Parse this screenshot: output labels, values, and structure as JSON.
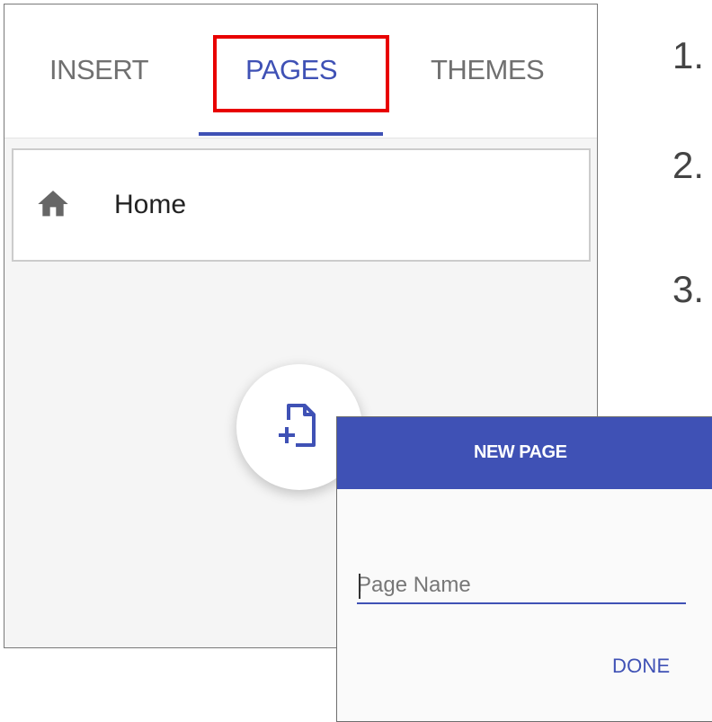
{
  "tabs": {
    "insert": "INSERT",
    "pages": "PAGES",
    "themes": "THEMES",
    "active": "PAGES"
  },
  "pages_list": [
    {
      "label": "Home",
      "icon": "home-icon"
    }
  ],
  "fab": {
    "icon": "add-page-icon"
  },
  "steps": [
    "1.",
    "2.",
    "3."
  ],
  "dialog": {
    "title": "NEW PAGE",
    "input_placeholder": "Page Name",
    "input_value": "",
    "done_label": "DONE"
  },
  "colors": {
    "accent": "#3f51b5",
    "highlight": "#e80000",
    "inactive_tab": "#707070",
    "icon_gray": "#666666"
  }
}
